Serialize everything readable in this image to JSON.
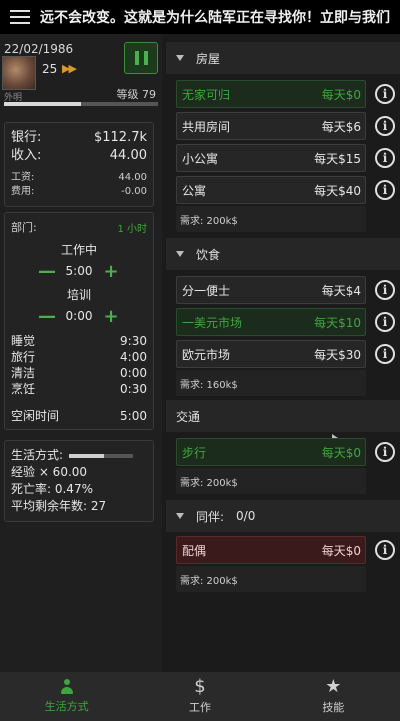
{
  "ticker": "远不会改变。这就是为什么陆军正在寻找你！立即与我们",
  "player": {
    "date": "22/02/1986",
    "age": "25",
    "avatar_caption": "外明",
    "level_label": "等级 79",
    "xp_fraction": 0.5
  },
  "finance": {
    "bank_label": "银行:",
    "bank_value": "$112.7k",
    "income_label": "收入:",
    "income_value": "44.00",
    "wage_label": "工资:",
    "wage_value": "44.00",
    "expense_label": "费用:",
    "expense_value": "-0.00"
  },
  "schedule": {
    "dept_label": "部门:",
    "dept_value": "1 小时",
    "work_title": "工作中",
    "work_value": "5:00",
    "train_title": "培训",
    "train_value": "0:00",
    "activities": [
      {
        "label": "睡觉",
        "value": "9:30"
      },
      {
        "label": "旅行",
        "value": "4:00"
      },
      {
        "label": "清洁",
        "value": "0:00"
      },
      {
        "label": "烹饪",
        "value": "0:30"
      }
    ],
    "idle_label": "空闲时间",
    "idle_value": "5:00"
  },
  "lifestyle": {
    "label": "生活方式:",
    "bar_fraction": 0.55,
    "xp": "经验 × 60.00",
    "death": "死亡率: 0.47%",
    "remaining": "平均剩余年数: 27"
  },
  "housing": {
    "title": "房屋",
    "items": [
      {
        "name": "无家可归",
        "price": "每天$0",
        "selected": true
      },
      {
        "name": "共用房间",
        "price": "每天$6",
        "selected": false
      },
      {
        "name": "小公寓",
        "price": "每天$15",
        "selected": false
      },
      {
        "name": "公寓",
        "price": "每天$40",
        "selected": false
      }
    ],
    "requirement": "需求: 200k$"
  },
  "food": {
    "title": "饮食",
    "items": [
      {
        "name": "分一便士",
        "price": "每天$4",
        "selected": false
      },
      {
        "name": "一美元市场",
        "price": "每天$10",
        "selected": true
      },
      {
        "name": "欧元市场",
        "price": "每天$30",
        "selected": false
      }
    ],
    "requirement": "需求: 160k$"
  },
  "transport": {
    "title": "交通",
    "items": [
      {
        "name": "步行",
        "price": "每天$0",
        "selected": true
      }
    ],
    "requirement": "需求: 200k$"
  },
  "partner": {
    "title": "同伴:",
    "count": "0/0",
    "items": [
      {
        "name": "配偶",
        "price": "每天$0"
      }
    ],
    "requirement": "需求: 200k$"
  },
  "nav": {
    "lifestyle": "生活方式",
    "work": "工作",
    "skills": "技能"
  },
  "colors": {
    "accent_green": "#3fa63f",
    "spouse_red": "#3a1a1a",
    "ff_orange": "#d89a2a"
  }
}
